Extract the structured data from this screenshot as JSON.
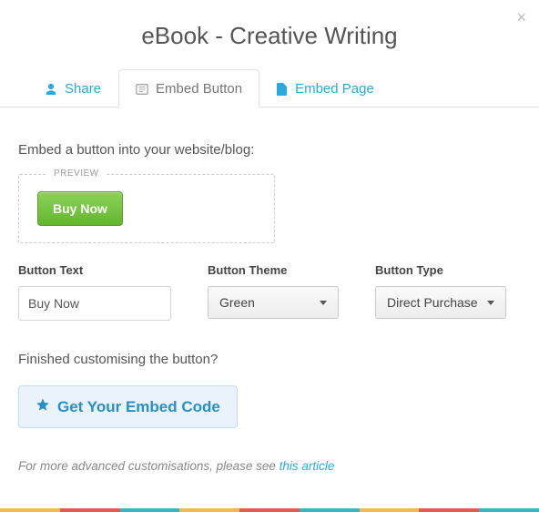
{
  "title": "eBook - Creative Writing",
  "tabs": {
    "share": "Share",
    "embed_button": "Embed Button",
    "embed_page": "Embed Page"
  },
  "instruction": "Embed a button into your website/blog:",
  "preview_label": "PREVIEW",
  "preview_button": "Buy Now",
  "fields": {
    "button_text": {
      "label": "Button Text",
      "value": "Buy Now"
    },
    "button_theme": {
      "label": "Button Theme",
      "value": "Green"
    },
    "button_type": {
      "label": "Button Type",
      "value": "Direct Purchase"
    }
  },
  "finished_prompt": "Finished customising the button?",
  "get_code_label": "Get Your Embed Code",
  "advanced_text": "For more advanced customisations, please see ",
  "advanced_link": "this article",
  "stripe_colors": [
    "#f3b84f",
    "#e55a4e",
    "#36b6c0",
    "#f3b84f",
    "#e55a4e",
    "#36b6c0",
    "#f3b84f",
    "#e55a4e",
    "#36b6c0"
  ]
}
